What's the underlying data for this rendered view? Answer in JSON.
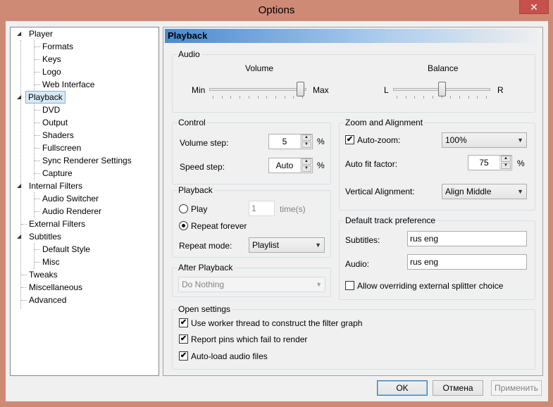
{
  "window": {
    "title": "Options",
    "close_glyph": "✕"
  },
  "tree": {
    "items": [
      {
        "label": "Player",
        "expanded": true
      },
      {
        "label": "Formats"
      },
      {
        "label": "Keys"
      },
      {
        "label": "Logo"
      },
      {
        "label": "Web Interface"
      },
      {
        "label": "Playback",
        "expanded": true,
        "selected": true
      },
      {
        "label": "DVD"
      },
      {
        "label": "Output"
      },
      {
        "label": "Shaders"
      },
      {
        "label": "Fullscreen"
      },
      {
        "label": "Sync Renderer Settings"
      },
      {
        "label": "Capture"
      },
      {
        "label": "Internal Filters",
        "expanded": true
      },
      {
        "label": "Audio Switcher"
      },
      {
        "label": "Audio Renderer"
      },
      {
        "label": "External Filters"
      },
      {
        "label": "Subtitles",
        "expanded": true
      },
      {
        "label": "Default Style"
      },
      {
        "label": "Misc"
      },
      {
        "label": "Tweaks"
      },
      {
        "label": "Miscellaneous"
      },
      {
        "label": "Advanced"
      }
    ]
  },
  "page": {
    "title": "Playback",
    "audio": {
      "group": "Audio",
      "volume_label": "Volume",
      "volume_min": "Min",
      "volume_max": "Max",
      "volume_level": 0.98,
      "balance_label": "Balance",
      "balance_left": "L",
      "balance_right": "R",
      "balance_level": 0.5
    },
    "control": {
      "group": "Control",
      "volume_step_label": "Volume step:",
      "volume_step_value": "5",
      "volume_step_unit": "%",
      "speed_step_label": "Speed step:",
      "speed_step_value": "Auto",
      "speed_step_unit": "%"
    },
    "zoom": {
      "group": "Zoom and Alignment",
      "autozoom_label": "Auto-zoom:",
      "autozoom_checked": true,
      "autozoom_value": "100%",
      "autofit_label": "Auto fit factor:",
      "autofit_value": "75",
      "autofit_unit": "%",
      "valign_label": "Vertical Alignment:",
      "valign_value": "Align Middle"
    },
    "playback": {
      "group": "Playback",
      "play_label": "Play",
      "play_times_value": "1",
      "times_label": "time(s)",
      "repeat_forever_label": "Repeat forever",
      "repeat_mode_label": "Repeat mode:",
      "repeat_mode_value": "Playlist"
    },
    "after": {
      "group": "After Playback",
      "value": "Do Nothing"
    },
    "track": {
      "group": "Default track preference",
      "subtitles_label": "Subtitles:",
      "subtitles_value": "rus eng",
      "audio_label": "Audio:",
      "audio_value": "rus eng",
      "override_label": "Allow overriding external splitter choice"
    },
    "open": {
      "group": "Open settings",
      "worker_label": "Use worker thread to construct the filter graph",
      "report_label": "Report pins which fail to render",
      "autoload_label": "Auto-load audio files"
    }
  },
  "buttons": {
    "ok": "OK",
    "cancel": "Отмена",
    "apply": "Применить"
  },
  "glyphs": {
    "check": "✔",
    "spin_up": "▲",
    "spin_down": "▼",
    "dropdown": "▼",
    "expand": "◢"
  },
  "colors": {
    "frame": "#cf8a76",
    "close": "#c7504b",
    "header_gradient": "#4a8ad0",
    "selection": "#d9eaf7"
  }
}
